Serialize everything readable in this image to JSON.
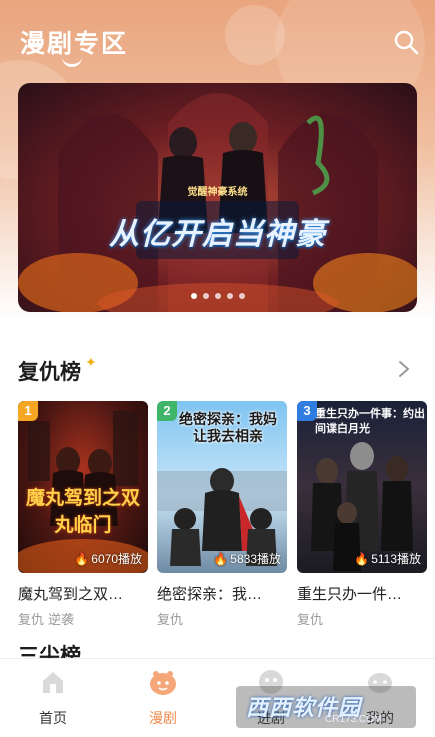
{
  "header": {
    "title": "漫剧专区",
    "search_icon": "search-icon"
  },
  "banner": {
    "title_text": "从亿开启当神豪",
    "subtitle_text": "觉醒神豪系统",
    "dots": 5,
    "active_dot": 0
  },
  "section": {
    "title": "复仇榜",
    "more_icon": "chevron-right-icon",
    "items": [
      {
        "rank": "1",
        "rank_color": "#f5a623",
        "name": "魔丸驾到之双…",
        "plays": "6070播放",
        "tags": [
          "复仇",
          "逆袭"
        ],
        "cover_text": "魔丸驾到之双丸临门"
      },
      {
        "rank": "2",
        "rank_color": "#3fb56a",
        "name": "绝密探亲：我…",
        "plays": "5833播放",
        "tags": [
          "复仇"
        ],
        "cover_text": "绝密探亲：我妈让我去相亲"
      },
      {
        "rank": "3",
        "rank_color": "#2f7de1",
        "name": "重生只办一件…",
        "plays": "5113播放",
        "tags": [
          "复仇"
        ],
        "cover_text": "重生只办一件事：约出间谍白月光"
      }
    ]
  },
  "next_section": {
    "title": "三尖榜"
  },
  "nav": {
    "items": [
      {
        "label": "首页",
        "icon": "home-icon",
        "active": false
      },
      {
        "label": "漫剧",
        "icon": "comic-icon",
        "active": true
      },
      {
        "label": "进剧",
        "icon": "theater-icon",
        "active": false
      },
      {
        "label": "我的",
        "icon": "profile-icon",
        "active": false
      }
    ]
  },
  "watermark": {
    "text": "西西软件园",
    "url": "CR173.COM"
  }
}
